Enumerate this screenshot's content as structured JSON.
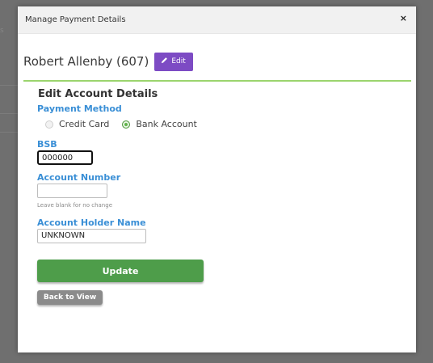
{
  "background": {
    "partial_text": "s"
  },
  "modal": {
    "title": "Manage Payment Details",
    "close_label": "×"
  },
  "person": {
    "name": "Robert Allenby (607)",
    "edit_label": "Edit"
  },
  "form": {
    "section_title": "Edit Account Details",
    "payment_method_label": "Payment Method",
    "payment_options": [
      {
        "label": "Credit Card",
        "checked": false
      },
      {
        "label": "Bank Account",
        "checked": true
      }
    ],
    "bsb_label": "BSB",
    "bsb_value": "000000",
    "account_number_label": "Account Number",
    "account_number_value": "",
    "account_number_hint": "Leave blank for no change",
    "holder_label": "Account Holder Name",
    "holder_value": "UNKNOWN"
  },
  "actions": {
    "update_label": "Update",
    "back_label": "Back to View"
  },
  "colors": {
    "accent_purple": "#7d4bc4",
    "label_blue": "#3a8fd6",
    "divider_green": "#9bd46e",
    "update_green": "#4e9d4a",
    "back_gray": "#8b8b8b"
  }
}
